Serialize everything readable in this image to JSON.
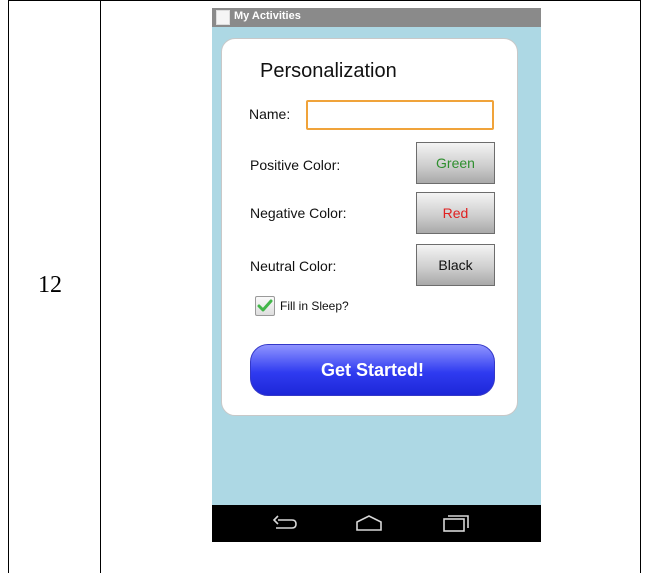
{
  "table": {
    "row_number": "12"
  },
  "app": {
    "title": "My Activities",
    "screen_title": "Personalization",
    "name": {
      "label": "Name:",
      "value": ""
    },
    "colors": [
      {
        "label": "Positive Color:",
        "button": "Green",
        "color": "#2f8f2f"
      },
      {
        "label": "Negative Color:",
        "button": "Red",
        "color": "#e02020"
      },
      {
        "label": "Neutral Color:",
        "button": "Black",
        "color": "#111111"
      }
    ],
    "fill_sleep": {
      "label": "Fill in Sleep?",
      "checked": true
    },
    "start_button": "Get Started!"
  },
  "nav": {
    "icons": [
      "back-icon",
      "home-icon",
      "recent-apps-icon"
    ]
  },
  "theme": {
    "background": "#add8e4",
    "accent": "#f0a33a",
    "button_blue": "#2f3bf0"
  }
}
